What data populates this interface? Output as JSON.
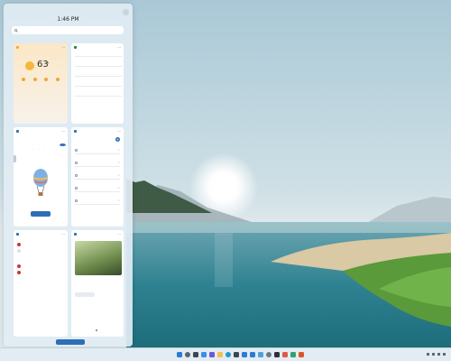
{
  "clock": {
    "time": "1:46 PM"
  },
  "search": {
    "placeholder": ""
  },
  "weather": {
    "header": "",
    "location": "",
    "temperature": "63",
    "unit": "°F",
    "condition_lines": [
      "",
      ""
    ],
    "forecast": [
      {
        "day": "",
        "hi": "",
        "lo": ""
      },
      {
        "day": "",
        "hi": "",
        "lo": ""
      },
      {
        "day": "",
        "hi": "",
        "lo": ""
      },
      {
        "day": "",
        "hi": "",
        "lo": ""
      }
    ],
    "link": ""
  },
  "stocks": {
    "header": "",
    "rows": [
      {
        "symbol": "",
        "price": "",
        "change": ""
      },
      {
        "symbol": "",
        "price": "",
        "change": ""
      },
      {
        "symbol": "",
        "price": "",
        "change": ""
      },
      {
        "symbol": "",
        "price": "",
        "change": ""
      },
      {
        "symbol": "",
        "price": "",
        "change": ""
      }
    ],
    "link": ""
  },
  "calendar": {
    "header": "",
    "month": "",
    "message": "",
    "button": ""
  },
  "todo": {
    "header": "",
    "title": "",
    "items": [
      "",
      "",
      "",
      "",
      ""
    ]
  },
  "sports": {
    "header": "",
    "rows": [
      {
        "team": "",
        "score": ""
      },
      {
        "team": "",
        "score": ""
      },
      {
        "team": "",
        "score": ""
      },
      {
        "team": "",
        "score": ""
      }
    ]
  },
  "photos": {
    "header": "",
    "caption": "",
    "button": ""
  },
  "panel": {
    "add_widgets_label": ""
  },
  "colors": {
    "accent": "#2d6fb5",
    "panel_bg": "#e1ecf3",
    "positive": "#1f8a3c"
  },
  "icons": {
    "taskbar": [
      "windows-logo-icon",
      "search-icon",
      "task-view-icon",
      "widgets-icon",
      "chat-icon",
      "file-explorer-icon",
      "edge-browser-icon",
      "store-icon",
      "mail-icon",
      "calendar-app-icon",
      "photos-app-icon",
      "settings-icon",
      "terminal-icon",
      "media-icon",
      "maps-icon",
      "office-icon"
    ],
    "tray": [
      "chevron-up-icon",
      "network-icon",
      "volume-icon",
      "battery-icon"
    ]
  }
}
